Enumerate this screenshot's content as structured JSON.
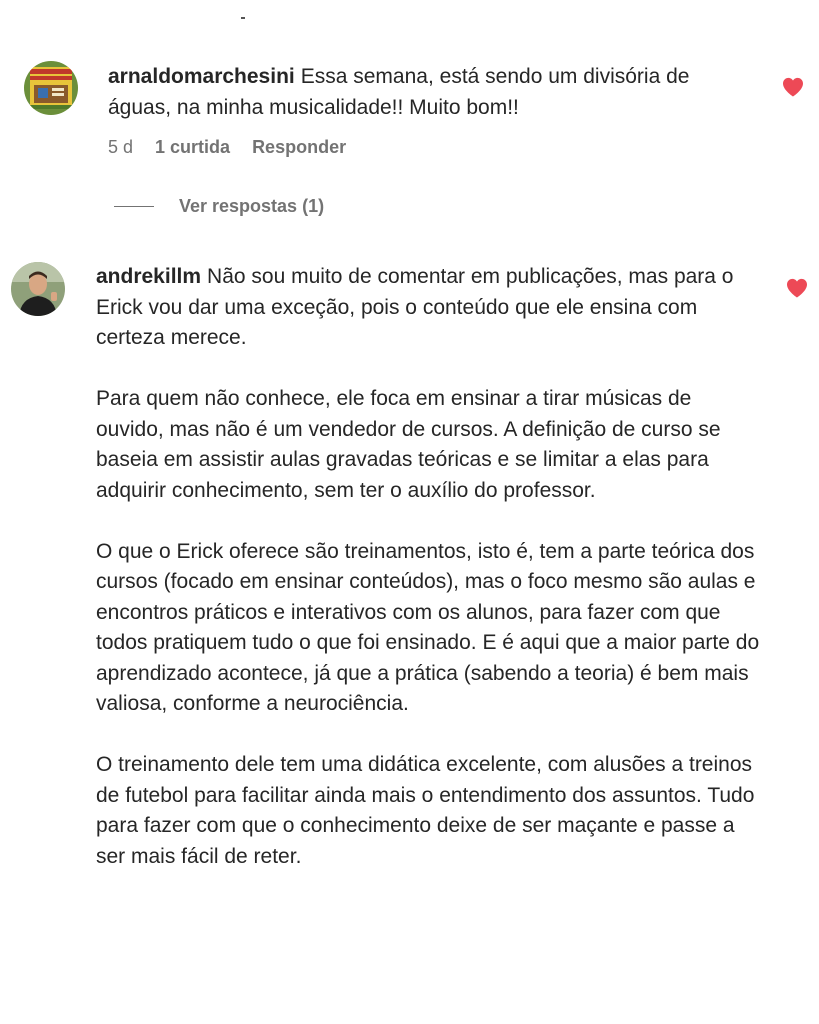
{
  "accent": "#ed4956",
  "comments": [
    {
      "username": "arnaldomarchesini",
      "avatar_icon": "avatar-icon",
      "paragraphs": [
        "Essa semana, está sendo um divisória de águas, na minha musicalidade!! Muito bom!!"
      ],
      "time": "5 d",
      "likes": "1 curtida",
      "reply_label": "Responder",
      "view_replies": "Ver respostas (1)",
      "liked": true
    },
    {
      "username": "andrekillm",
      "avatar_icon": "avatar-icon",
      "paragraphs": [
        "Não sou muito de comentar em publicações, mas para o Erick vou dar uma exceção, pois o conteúdo que ele ensina com certeza merece.",
        "Para quem não conhece, ele foca em ensinar a tirar músicas de ouvido, mas não é um vendedor de cursos. A definição de curso se baseia em assistir aulas gravadas teóricas e se limitar a elas para adquirir conhecimento, sem ter o auxílio do professor.",
        "O que o Erick oferece são treinamentos, isto é, tem a parte teórica dos cursos (focado em ensinar conteúdos), mas o foco mesmo são aulas e encontros práticos e interativos com os alunos, para fazer com que todos pratiquem tudo o que foi ensinado. E é aqui que a maior parte do aprendizado acontece, já que a prática (sabendo a teoria) é bem mais valiosa, conforme a neurociência.",
        "O treinamento dele tem uma didática excelente, com alusões a treinos de futebol para facilitar ainda mais o entendimento dos assuntos. Tudo para fazer com que o conhecimento deixe de ser maçante e passe a ser mais fácil de reter."
      ],
      "liked": true
    }
  ]
}
